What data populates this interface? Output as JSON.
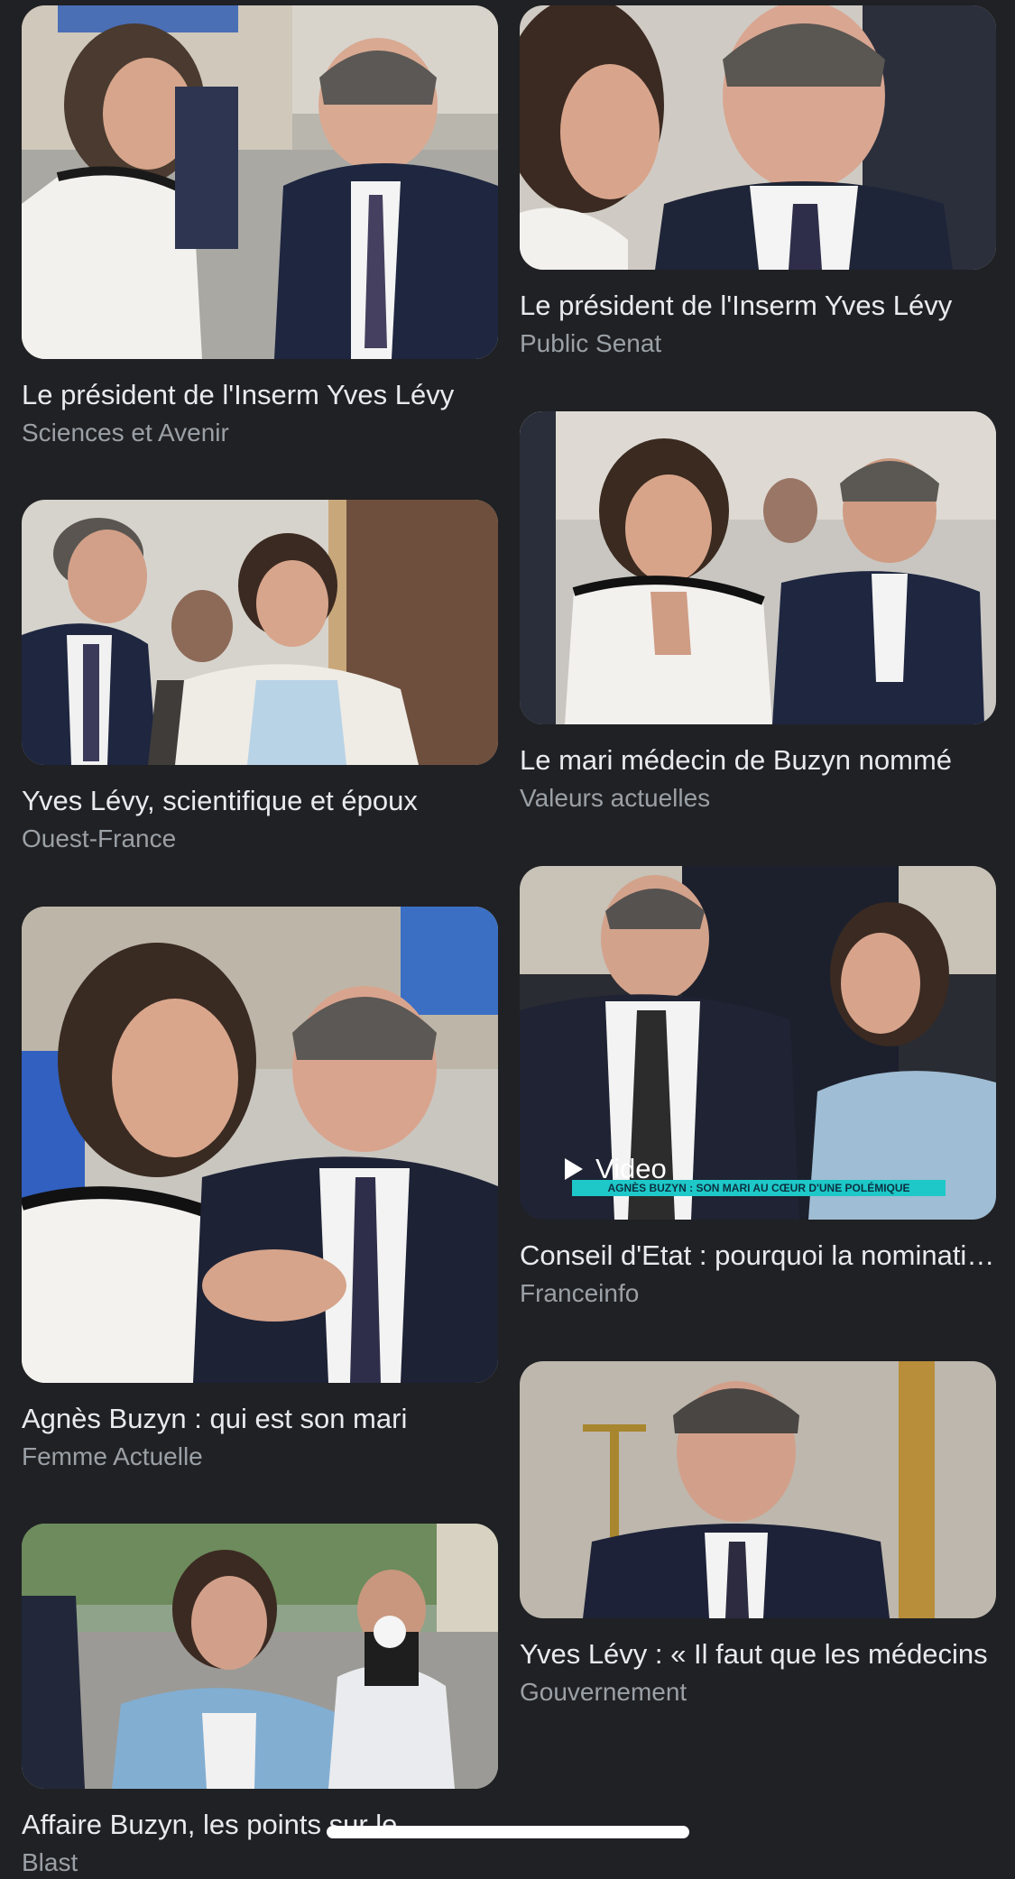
{
  "results": {
    "left": [
      {
        "title": "Le président de l'Inserm Yves Lévy",
        "source": "Sciences et Avenir",
        "image": "photo-couple-outdoor"
      },
      {
        "title": "Yves Lévy, scientifique et époux",
        "source": "Ouest-France",
        "image": "photo-couple-corridor"
      },
      {
        "title": "Agnès Buzyn : qui est son mari",
        "source": "Femme Actuelle",
        "image": "photo-couple-closeup"
      },
      {
        "title": "Affaire Buzyn, les points sur le",
        "source": "Blast",
        "image": "photo-woman-press"
      }
    ],
    "right": [
      {
        "title": "Le président de l'Inserm Yves Lévy",
        "source": "Public Senat",
        "image": "photo-couple-talking"
      },
      {
        "title": "Le mari médecin de Buzyn nommé",
        "source": "Valeurs actuelles",
        "image": "photo-couple-crowd"
      },
      {
        "title": "Conseil d'Etat : pourquoi la nomination",
        "source": "Franceinfo",
        "image": "video-thumbnail",
        "badge": "Video",
        "ticker": "AGNÈS BUZYN : SON MARI AU CŒUR D'UNE POLÉMIQUE"
      },
      {
        "title": "Yves Lévy : « Il faut que les médecins",
        "source": "Gouvernement",
        "image": "photo-portrait"
      }
    ]
  }
}
